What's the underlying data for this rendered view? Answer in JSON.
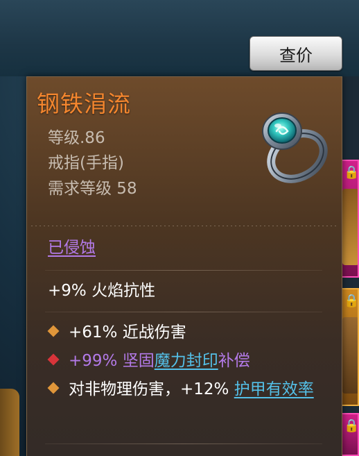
{
  "header": {
    "price_button_label": "查价"
  },
  "item": {
    "name": "钢铁涓流",
    "level_text": "等级.86",
    "slot_text": "戒指(手指)",
    "required_level_text": "需求等级 58",
    "icon": "ring-icon",
    "corroded_label": "已侵蚀",
    "implicit": "+9% 火焰抗性",
    "affixes": [
      {
        "marker": "orange-diamond",
        "marker_color": "#e0963a",
        "text": "+61% 近战伤害"
      },
      {
        "marker": "red-diamond",
        "marker_color": "#d8343a",
        "prefix": "+99% 坚固",
        "link": "魔力封印",
        "suffix": "补偿"
      },
      {
        "marker": "orange-diamond",
        "marker_color": "#e0963a",
        "prefix": "对非物理伤害，+12% ",
        "link": "护甲有效率"
      }
    ]
  },
  "colors": {
    "item_name": "#f4862e",
    "stat_text": "#c7bcb0",
    "corroded": "#b37ae8",
    "keyword_link": "#54c0e8"
  }
}
